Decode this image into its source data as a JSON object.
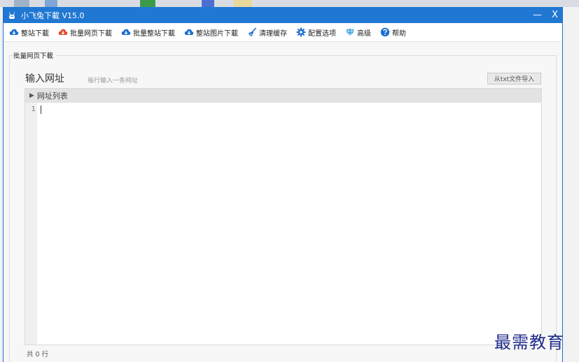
{
  "window": {
    "title": "小飞兔下載 V15.0",
    "minimize_glyph": "—",
    "close_glyph": "X",
    "accent": "#2178d2"
  },
  "toolbar": {
    "items": [
      {
        "label": "整站下載",
        "icon": "cloud-download-icon",
        "color": "#1e6fd0"
      },
      {
        "label": "批量网页下載",
        "icon": "cloud-download-icon",
        "color": "#e24a2c"
      },
      {
        "label": "批量整站下載",
        "icon": "cloud-download-icon",
        "color": "#1e6fd0"
      },
      {
        "label": "整站图片下載",
        "icon": "cloud-download-icon",
        "color": "#1e6fd0"
      },
      {
        "label": "清理缓存",
        "icon": "broom-icon",
        "color": "#1e6fd0"
      },
      {
        "label": "配置选项",
        "icon": "gear-icon",
        "color": "#1e6fd0"
      },
      {
        "label": "高级",
        "icon": "diamond-icon",
        "color": "#2a9be0"
      },
      {
        "label": "帮助",
        "icon": "help-icon",
        "color": "#1e6fd0"
      }
    ]
  },
  "panel": {
    "group_title": "批量网页下載",
    "heading": "输入网址",
    "hint": "每行输入一条网址",
    "import_button": "从txt文件导入",
    "list_header": "网址列表",
    "line_number": "1",
    "status": "共 0 行"
  },
  "watermark": "最需教育"
}
